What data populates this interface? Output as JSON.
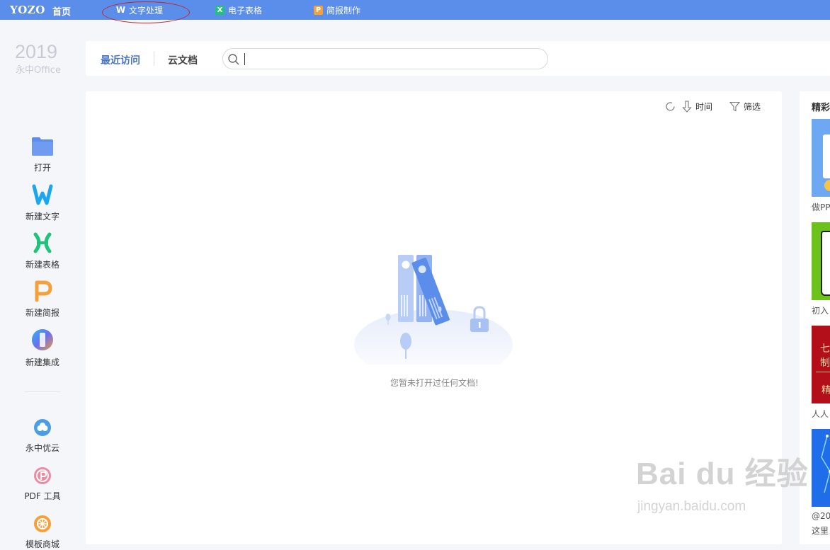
{
  "topbar": {
    "logo": "YOZO",
    "home": "首页",
    "tabs": [
      {
        "label": "文字处理",
        "icon": "writer-w-icon",
        "color": "#5b8dea"
      },
      {
        "label": "电子表格",
        "icon": "sheet-x-icon",
        "color": "#1fc47a"
      },
      {
        "label": "简报制作",
        "icon": "slides-p-icon",
        "color": "#f5a03a"
      }
    ]
  },
  "brand": {
    "year": "2019",
    "product": "永中Office"
  },
  "header": {
    "tab_recent": "最近访问",
    "tab_cloud": "云文档",
    "search_placeholder": ""
  },
  "sidebar": {
    "actions": [
      {
        "label": "打开",
        "icon": "folder-icon"
      },
      {
        "label": "新建文字",
        "icon": "writer-w-icon"
      },
      {
        "label": "新建表格",
        "icon": "sheet-x-icon"
      },
      {
        "label": "新建简报",
        "icon": "slides-p-icon"
      },
      {
        "label": "新建集成",
        "icon": "integrated-icon"
      }
    ],
    "services": [
      {
        "label": "永中优云",
        "icon": "cloud-service-icon"
      },
      {
        "label": "PDF 工具",
        "icon": "pdf-tool-icon"
      },
      {
        "label": "模板商城",
        "icon": "template-store-icon"
      }
    ]
  },
  "main": {
    "sort_label": "时间",
    "filter_label": "筛选",
    "empty_message": "您暂未打开过任何文档!"
  },
  "right_panel": {
    "title": "精彩",
    "items": [
      {
        "caption": "做PP"
      },
      {
        "caption": "初入"
      },
      {
        "caption": "人人"
      },
      {
        "caption": "@20"
      },
      {
        "caption": "这里"
      }
    ]
  },
  "watermark": {
    "brand": "Bai du 经验",
    "url": "jingyan.baidu.com"
  },
  "colors": {
    "topbar": "#5b8dea",
    "accent": "#4a76c7",
    "writer": "#1ba7f0",
    "sheet": "#1fc47a",
    "slides": "#f5a03a",
    "annotation": "#c0272d"
  }
}
